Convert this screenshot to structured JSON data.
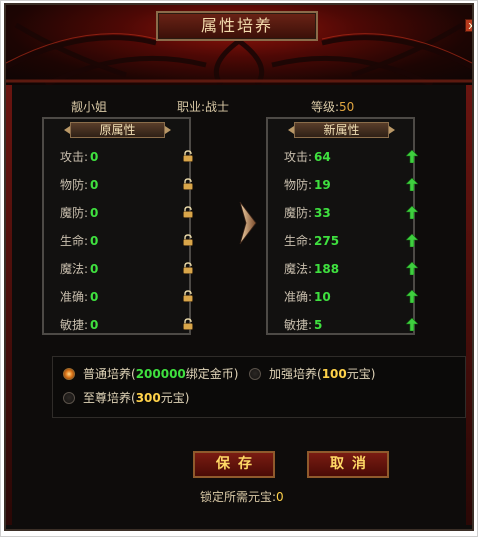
{
  "title": "属性培养",
  "close_label": "x",
  "character": {
    "name": "靓小姐",
    "class_label": "职业:战士",
    "level_label": "等级:",
    "level_value": "50"
  },
  "left_panel": {
    "header": "原属性",
    "rows": [
      {
        "label": "攻击:",
        "value": "0"
      },
      {
        "label": "物防:",
        "value": "0"
      },
      {
        "label": "魔防:",
        "value": "0"
      },
      {
        "label": "生命:",
        "value": "0"
      },
      {
        "label": "魔法:",
        "value": "0"
      },
      {
        "label": "准确:",
        "value": "0"
      },
      {
        "label": "敏捷:",
        "value": "0"
      }
    ]
  },
  "right_panel": {
    "header": "新属性",
    "rows": [
      {
        "label": "攻击:",
        "value": "64"
      },
      {
        "label": "物防:",
        "value": "19"
      },
      {
        "label": "魔防:",
        "value": "33"
      },
      {
        "label": "生命:",
        "value": "275"
      },
      {
        "label": "魔法:",
        "value": "188"
      },
      {
        "label": "准确:",
        "value": "10"
      },
      {
        "label": "敏捷:",
        "value": "5"
      }
    ]
  },
  "options": {
    "normal": {
      "prefix": "普通培养(",
      "amount": "200000",
      "suffix": "绑定金币)",
      "selected": true
    },
    "enhanced": {
      "prefix": "加强培养(",
      "amount": "100",
      "suffix": "元宝)",
      "selected": false
    },
    "supreme": {
      "prefix": "至尊培养(",
      "amount": "300",
      "suffix": "元宝)",
      "selected": false
    }
  },
  "buttons": {
    "save": "保存",
    "cancel": "取消"
  },
  "lock_cost": {
    "label": "锁定所需元宝:",
    "value": "0"
  },
  "colors": {
    "stat_value": "#3fe03f",
    "gold_amount": "#ffd24a",
    "button_text": "#ffd966"
  }
}
